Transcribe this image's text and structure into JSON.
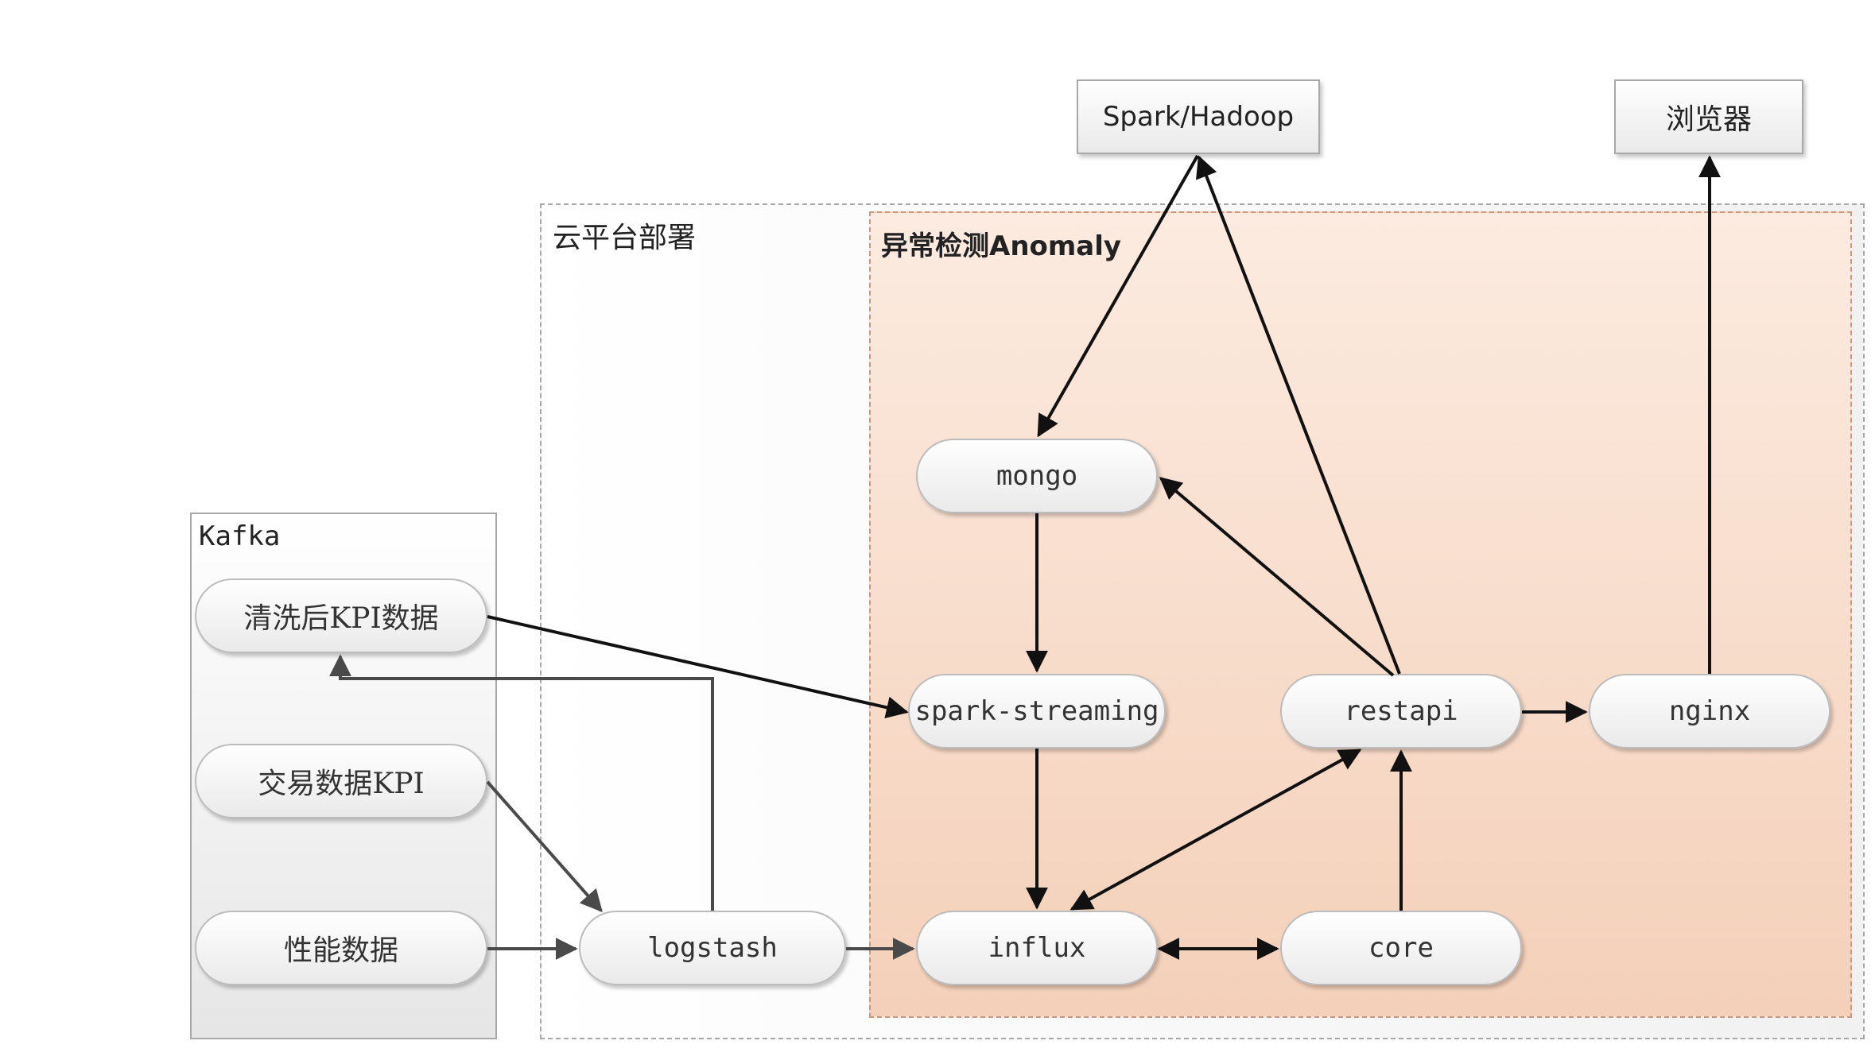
{
  "regions": {
    "kafka": "Kafka",
    "cloud": "云平台部署",
    "anomaly": "异常检测Anomaly"
  },
  "nodes": {
    "kpi_clean": "清洗后KPI数据",
    "trade_kpi": "交易数据KPI",
    "perf_data": "性能数据",
    "logstash": "logstash",
    "mongo": "mongo",
    "spark_streaming": "spark-streaming",
    "influx": "influx",
    "restapi": "restapi",
    "core": "core",
    "nginx": "nginx",
    "spark_hadoop": "Spark/Hadoop",
    "browser": "浏览器"
  },
  "edges": [
    {
      "from": "spark_hadoop",
      "to": "mongo"
    },
    {
      "from": "restapi",
      "to": "spark_hadoop"
    },
    {
      "from": "mongo",
      "to": "spark_streaming"
    },
    {
      "from": "restapi",
      "to": "mongo"
    },
    {
      "from": "kpi_clean",
      "to": "spark_streaming"
    },
    {
      "from": "logstash",
      "to": "kpi_clean"
    },
    {
      "from": "trade_kpi",
      "to": "logstash"
    },
    {
      "from": "perf_data",
      "to": "logstash"
    },
    {
      "from": "logstash",
      "to": "influx"
    },
    {
      "from": "spark_streaming",
      "to": "influx"
    },
    {
      "from": "influx",
      "to": "restapi",
      "bidirectional": true
    },
    {
      "from": "influx",
      "to": "core",
      "bidirectional": true
    },
    {
      "from": "core",
      "to": "restapi"
    },
    {
      "from": "restapi",
      "to": "nginx"
    },
    {
      "from": "nginx",
      "to": "browser"
    }
  ],
  "colors": {
    "arrow": "#111111",
    "arrow_gray": "#4a4a4a",
    "anomaly_fill": "#f6d6c2",
    "border": "#a8a8a8"
  }
}
